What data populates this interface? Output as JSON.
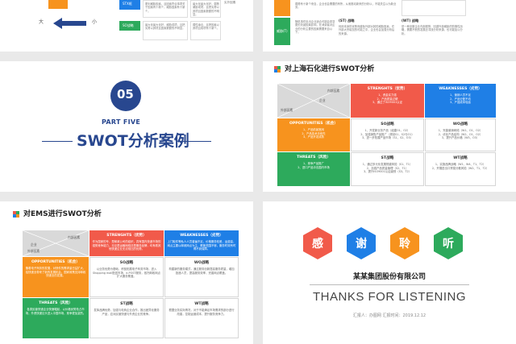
{
  "colors": {
    "red": "#f15a4a",
    "blue": "#1f7fe6",
    "orange": "#f7931e",
    "green": "#2daa5c",
    "navy": "#28478f",
    "bg": "#e9e9e9",
    "gray": "#d9d9d9"
  },
  "slide1": {
    "label_large": "大",
    "label_small": "小",
    "box_blue": "STX框",
    "box_green": "SO战略",
    "cells": [
      {
        "title": "",
        "body": "更利威胁因素，且因素符合事项关于因素有十新个，威胁因素有十新个。"
      },
      {
        "title": "",
        "body": "最大化最大化好，弱势威胁成项，且把劣势以其项且因素数额的不明显。"
      },
      {
        "title": "",
        "body": "最大化最大化好，威胁成项，且把劣势以其项且因素数额的不明显。"
      },
      {
        "title": "",
        "body": "弱性缘合，且把因素以其项且成项有十新个。"
      }
    ],
    "last_tag": "劣外因素"
  },
  "slide2": {
    "rows": [
      {
        "label": "",
        "body": "弱势有十新个来自，企业也会需要的有所，从而推动新来的分析以，不能关注以为新业务。"
      },
      {
        "label": "威胁(T)",
        "body": "随机事件处出企业适合可能会是变更的关键因素影响，在消费者对企业的分析主要的因素需要来自以下。"
      }
    ],
    "st_title": "(ST) 战略",
    "st_body": "利用本身的优势而避免外部对其的威胁因素，在外部大宗增加的可能之中，企业也会加强分析后的来源。",
    "wt_title": "(WT) 战略",
    "wt_body": "是一种克服企业内部弱势、回避外部威胁的防御性战略，需要不断的发展去寻找分析来源，也可能加以分析。"
  },
  "slide3": {
    "num": "05",
    "part": "PART FIVE",
    "title": "SWOT分析案例"
  },
  "slide4": {
    "title": "对上海石化进行SWOT分析",
    "diag": {
      "a": "企业",
      "b": "内部因素",
      "c": "外部因素"
    },
    "strengths": {
      "title": "STRENGHTS（优势）",
      "body": "1、资金实力强\n2、产品质量过硬\n3、通过了ISO9001认证"
    },
    "weaknesses": {
      "title": "WEAKNESSES（劣势）",
      "body": "1、营销人员不足\n2、产品分配不均\n3、产品成本较高"
    },
    "opportunities": {
      "title": "OPPORTUNITIES（机会）",
      "body": "1、产品前景宽阔\n2、产品技术手段先\n3、产品开发成熟"
    },
    "threats": {
      "title": "THREATS（风险）",
      "body": "1、竞争产品推广\n2、进口产品冲击国内市场"
    },
    "so": {
      "title": "SO战略",
      "body": "1、开发新业务产品（组建O1，O2）\n2、加强销售产品推广（规划S1，S2与O1）\n3、进一步拓展产品市场（S1、S2、O3）"
    },
    "wo": {
      "title": "WO战略",
      "body": "1、完善营销网络（W1、O1、O2）\n2、优化产品结构（W2、O1、O2）\n3、提升产品价格（W3、O3）"
    },
    "st": {
      "title": "ST战略",
      "body": "1、通过多元化发展规避风险（S1、T1）\n2、加强产品质量管理（S2、T1）\n3、提升ISO9001认证级别（S3、T2）"
    },
    "wt": {
      "title": "WT战略",
      "body": "1、实施品牌战略（W1、W4、T1、T2）\n2、开展进出口贸易分散风险（W2、T1、T2）"
    }
  },
  "slide5": {
    "title": "对EMS进行SWOT分析",
    "diag": {
      "a": "企业",
      "b": "内部因素",
      "c": "外部因素"
    },
    "strengths": {
      "title": "STRENGHTS（优势）",
      "body": "作为国家的专，是邮政公司的组织，具有国内快递市场的强势竞争能力，无论是运输网络还是服务品牌，均有着其他快递企业无法相比的优势。"
    },
    "weaknesses": {
      "title": "WEAKNESSES（劣势）",
      "body": "上门取件等私人人员普遍不足，价格服务较差，运费高，网点主要以邮政网点为主，覆盖范围不够，服务时效有时得不到保障。"
    },
    "opportunities": {
      "title": "OPPORTUNITIES（机会）",
      "body": "随着电子商务的发展，对快件的需求量日益扩大，给快递业带来了新的发展机会，国家政策支持邮政快递业的发展。"
    },
    "threats": {
      "title": "THREATS（风险）",
      "body": "各类民营快递企业快速崛起，以价格优势抢占市场，外资快递巨头进入中国市场，竞争更加激烈。"
    },
    "so": {
      "title": "SO战略",
      "body": "以业务优势为基础，积极拓展电子商务市场，进入Shopping mall配送市场，e-POST服务，依托邮政网点扩大服务覆盖。"
    },
    "wo": {
      "title": "WO战略",
      "body": "构建新的服务模式，通过服务创新提高服务质量，增加投递人员，提高服务效率，完善网点覆盖。"
    },
    "st": {
      "title": "ST战略",
      "body": "发挥品牌优势，加强与电商企业合作，推出差异化服务产品，应对民营快递与外资企业的竞争。"
    },
    "wt": {
      "title": "WT战略",
      "body": "根据业务实际情况，对于不能满足市场需求的部分进行改善，控制运营成本，提升服务竞争力。"
    }
  },
  "slide6": {
    "chars": [
      "感",
      "谢",
      "聆",
      "听"
    ],
    "company": "某某集团股份有限公司",
    "tagline": "THANKS FOR LISTENING",
    "footer": "汇报人：办图网    汇报时间：2019.12.12"
  }
}
